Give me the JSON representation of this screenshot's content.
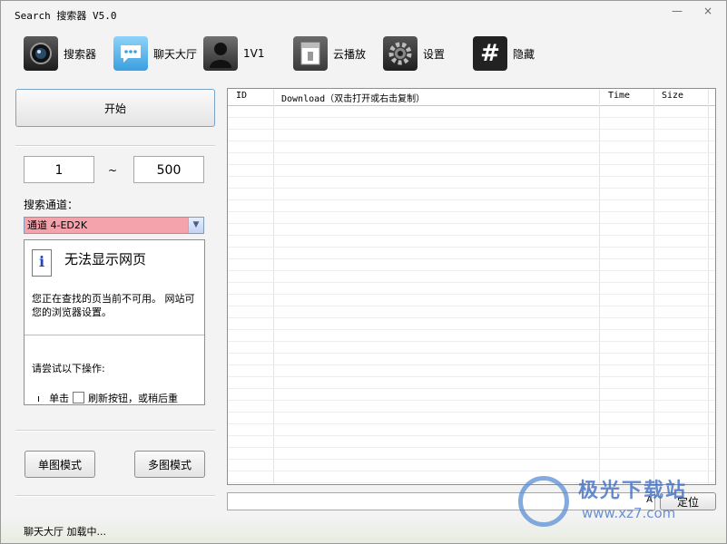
{
  "window": {
    "title": "Search 搜索器 V5.0",
    "minimize_symbol": "—",
    "close_symbol": "×"
  },
  "toolbar": [
    {
      "label": "搜索器",
      "icon": "camera-icon"
    },
    {
      "label": "聊天大厅",
      "icon": "chat-icon"
    },
    {
      "label": "1V1",
      "icon": "user-icon"
    },
    {
      "label": "云播放",
      "icon": "cloud-play-icon"
    },
    {
      "label": "设置",
      "icon": "gear-icon"
    },
    {
      "label": "隐藏",
      "icon": "hash-icon"
    }
  ],
  "left": {
    "start_label": "开始",
    "range_from": "1",
    "range_sep": "~",
    "range_to": "500",
    "channel_label": "搜索通道：",
    "channel_value": "通道 4-ED2K",
    "channel_color": "#f4a3ad",
    "browser": {
      "title": "无法显示网页",
      "text_line1": "您正在查找的页当前不可用。 网站可",
      "text_line2": "您的浏览器设置。",
      "try_text": "请尝试以下操作:",
      "step_bullet": "ı",
      "step_prefix": "单击",
      "step_suffix": "刷新按钮，或稍后重"
    },
    "single_mode_label": "单图模式",
    "multi_mode_label": "多图模式"
  },
  "grid": {
    "columns": [
      "ID",
      "Download（双击打开或右击复制）",
      "Time",
      "Size"
    ],
    "rows": []
  },
  "bottom": {
    "input_value": "",
    "input_suffix": "A",
    "locate_label": "定位"
  },
  "status": {
    "text": "聊天大厅 加载中..."
  },
  "watermark": {
    "name": "极光下载站",
    "url": "www.xz7.com"
  }
}
